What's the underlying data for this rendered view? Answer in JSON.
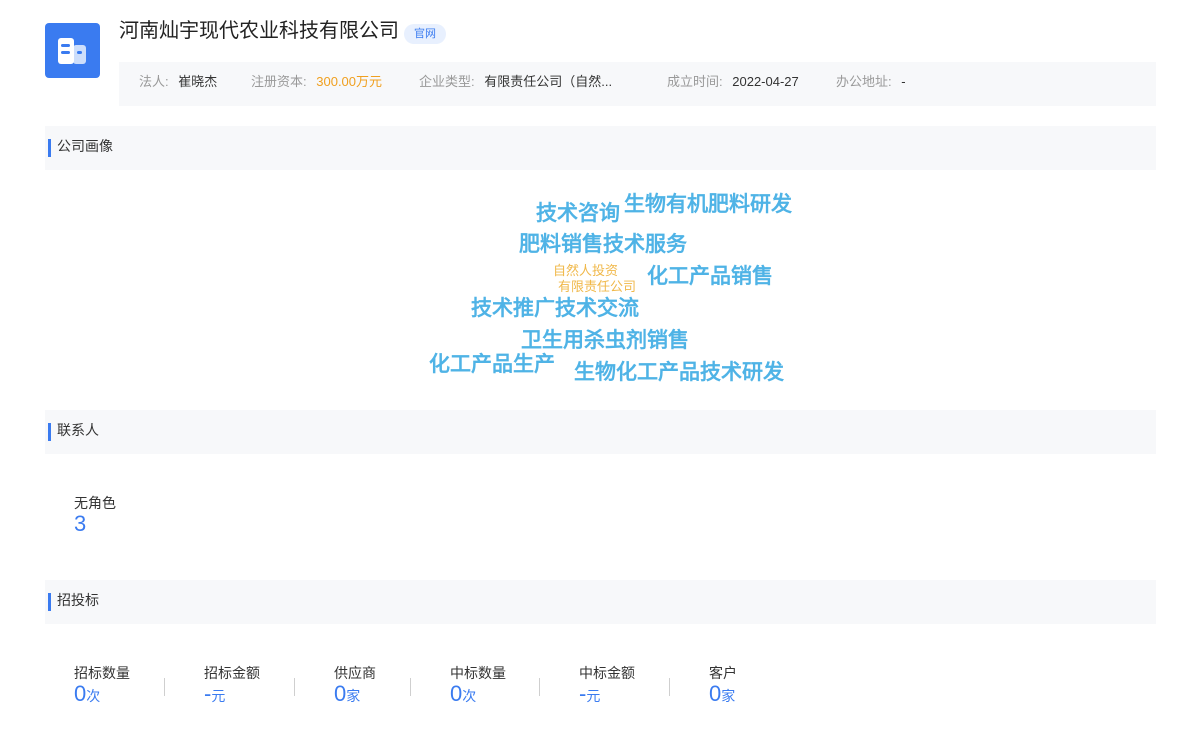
{
  "header": {
    "company_name": "河南灿宇现代农业科技有限公司",
    "official_site_badge": "官网",
    "info": {
      "legal_rep_label": "法人:",
      "legal_rep_value": "崔晓杰",
      "capital_label": "注册资本:",
      "capital_value": "300.00万元",
      "type_label": "企业类型:",
      "type_value": "有限责任公司（自然...",
      "founded_label": "成立时间:",
      "founded_value": "2022-04-27",
      "address_label": "办公地址:",
      "address_value": "-"
    }
  },
  "portrait": {
    "title": "公司画像",
    "words": [
      "技术咨询",
      "生物有机肥料研发",
      "肥料销售技术服务",
      "自然人投资",
      "有限责任公司",
      "化工产品销售",
      "技术推广技术交流",
      "卫生用杀虫剂销售",
      "化工产品生产",
      "生物化工产品技术研发"
    ]
  },
  "contacts": {
    "title": "联系人",
    "role_label": "无角色",
    "role_count": "3"
  },
  "bidding": {
    "title": "招投标",
    "stats": [
      {
        "label": "招标数量",
        "value": "0",
        "unit": "次"
      },
      {
        "label": "招标金额",
        "value": "-",
        "unit": "元"
      },
      {
        "label": "供应商",
        "value": "0",
        "unit": "家"
      },
      {
        "label": "中标数量",
        "value": "0",
        "unit": "次"
      },
      {
        "label": "中标金额",
        "value": "-",
        "unit": "元"
      },
      {
        "label": "客户",
        "value": "0",
        "unit": "家"
      }
    ]
  },
  "colors": {
    "accent": "#3a7bf0",
    "cloud_blue": "#4fb3e6",
    "cloud_orange": "#f0b84a",
    "capital_orange": "#f0a020"
  }
}
